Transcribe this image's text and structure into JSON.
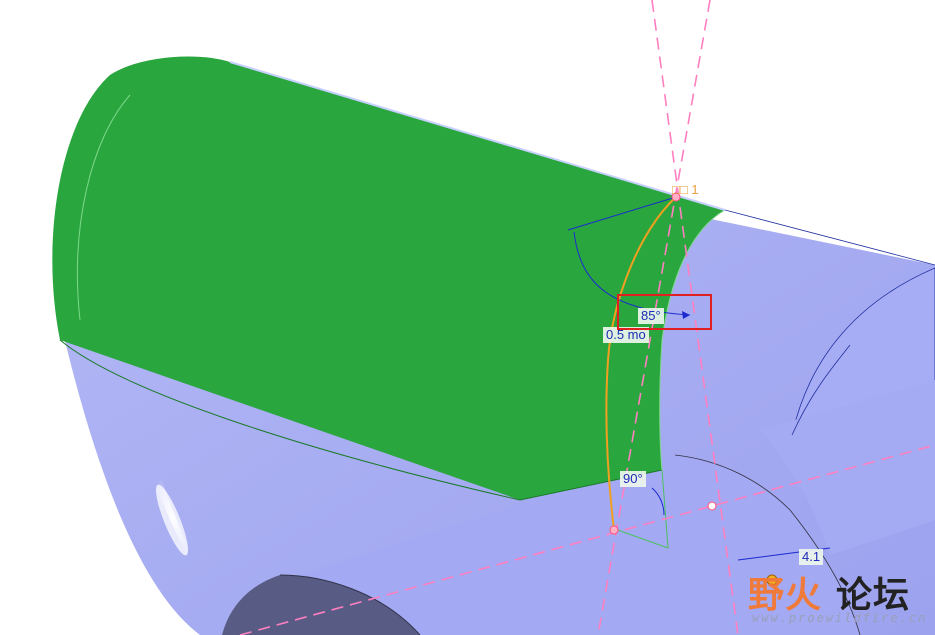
{
  "viewport": {
    "point_label": "□□ 1",
    "dimensions": {
      "angle_highlighted": "85°",
      "length": "0.5 mo",
      "angle_bottom": "90°",
      "distance": "4.1"
    }
  },
  "watermark": {
    "text_cn_part1": "野火",
    "text_cn_part2": "论坛",
    "url": "www.proewildfire.cn"
  },
  "colors": {
    "green_surface": "#2aa63e",
    "blue_body": "#a3aaf2",
    "dark_body": "#565a80",
    "sketch_curve": "#f0a020",
    "centerline": "#ff7fc0",
    "dimension_line": "#1a2ad0",
    "highlight": "#e02020"
  }
}
